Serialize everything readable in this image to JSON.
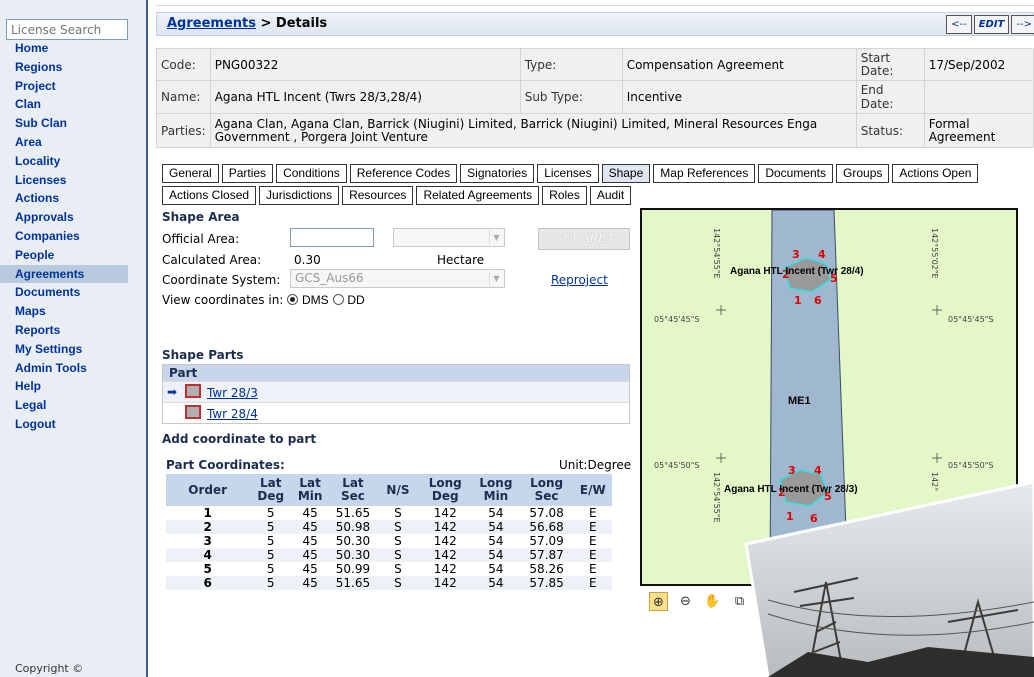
{
  "sidebar": {
    "search_placeholder": "License Search",
    "items": [
      "Home",
      "Regions",
      "Project",
      "Clan",
      "Sub Clan",
      "Area",
      "Locality",
      "Licenses",
      "Actions",
      "Approvals",
      "Companies",
      "People",
      "Agreements",
      "Documents",
      "Maps",
      "Reports",
      "My Settings",
      "Admin Tools",
      "Help",
      "Legal",
      "Logout"
    ],
    "active": "Agreements",
    "copyright": "Copyright ©"
  },
  "header": {
    "breadcrumb_link": "Agreements",
    "breadcrumb_rest": " > Details",
    "prev_label": "<--",
    "edit_label": "EDIT",
    "next_label": "-->"
  },
  "details": {
    "code_label": "Code:",
    "code": "PNG00322",
    "type_label": "Type:",
    "type": "Compensation Agreement",
    "start_label": "Start Date:",
    "start": "17/Sep/2002",
    "name_label": "Name:",
    "name": "Agana HTL Incent (Twrs 28/3,28/4)",
    "subtype_label": "Sub Type:",
    "subtype": "Incentive",
    "end_label": "End Date:",
    "end": "",
    "parties_label": "Parties:",
    "parties": "Agana Clan, Agana Clan, Barrick (Niugini) Limited, Barrick (Niugini) Limited, Mineral Resources Enga Government , Porgera Joint Venture",
    "status_label": "Status:",
    "status": "Formal Agreement"
  },
  "tabs": {
    "row1": [
      "General",
      "Parties",
      "Conditions",
      "Reference Codes",
      "Signatories",
      "Licenses",
      "Shape",
      "Map References",
      "Documents",
      "Groups",
      "Actions Open"
    ],
    "row2": [
      "Actions Closed",
      "Jurisdictions",
      "Resources",
      "Related Agreements",
      "Roles",
      "Audit"
    ],
    "active": "Shape"
  },
  "shape": {
    "title": "Shape Area",
    "official_label": "Official Area:",
    "official_value": "",
    "get_area": "GET AREA",
    "calc_label": "Calculated Area:",
    "calc_value": "0.30",
    "calc_unit": "Hectare",
    "cs_label": "Coordinate System:",
    "cs_value": "GCS_Aus66",
    "reproject": "Reproject",
    "view_label": "View coordinates in:",
    "dms": "DMS",
    "dd": "DD"
  },
  "parts": {
    "title": "Shape Parts",
    "header": "Part",
    "items": [
      "Twr 28/3",
      "Twr 28/4"
    ]
  },
  "coords": {
    "add_title": "Add coordinate to part",
    "title": "Part Coordinates:",
    "unit": "Unit:Degree",
    "headers": [
      "Order",
      "Lat Deg",
      "Lat Min",
      "Lat Sec",
      "N/S",
      "Long Deg",
      "Long Min",
      "Long Sec",
      "E/W"
    ],
    "rows": [
      [
        "1",
        "5",
        "45",
        "51.65",
        "S",
        "142",
        "54",
        "57.08",
        "E"
      ],
      [
        "2",
        "5",
        "45",
        "50.98",
        "S",
        "142",
        "54",
        "56.68",
        "E"
      ],
      [
        "3",
        "5",
        "45",
        "50.30",
        "S",
        "142",
        "54",
        "57.09",
        "E"
      ],
      [
        "4",
        "5",
        "45",
        "50.30",
        "S",
        "142",
        "54",
        "57.87",
        "E"
      ],
      [
        "5",
        "5",
        "45",
        "50.99",
        "S",
        "142",
        "54",
        "58.26",
        "E"
      ],
      [
        "6",
        "5",
        "45",
        "51.65",
        "S",
        "142",
        "54",
        "57.85",
        "E"
      ]
    ]
  },
  "map": {
    "lon_left_top": "142°54'55\"E",
    "lon_right_top": "142°55'02\"E",
    "lat_upper_left": "05°45'45\"S",
    "lat_upper_right": "05°45'45\"S",
    "lat_lower_left": "05°45'50\"S",
    "lat_lower_right": "05°45'50\"S",
    "lon_left_bottom": "142°54'55\"E",
    "lon_right_bottom": "142°",
    "label_top": "Agana HTL Incent (Twr 28/4)",
    "label_bottom": "Agana HTL Incent (Twr 28/3)",
    "corridor": "ME1",
    "vertex_labels": [
      "1",
      "2",
      "3",
      "4",
      "5",
      "6"
    ]
  }
}
